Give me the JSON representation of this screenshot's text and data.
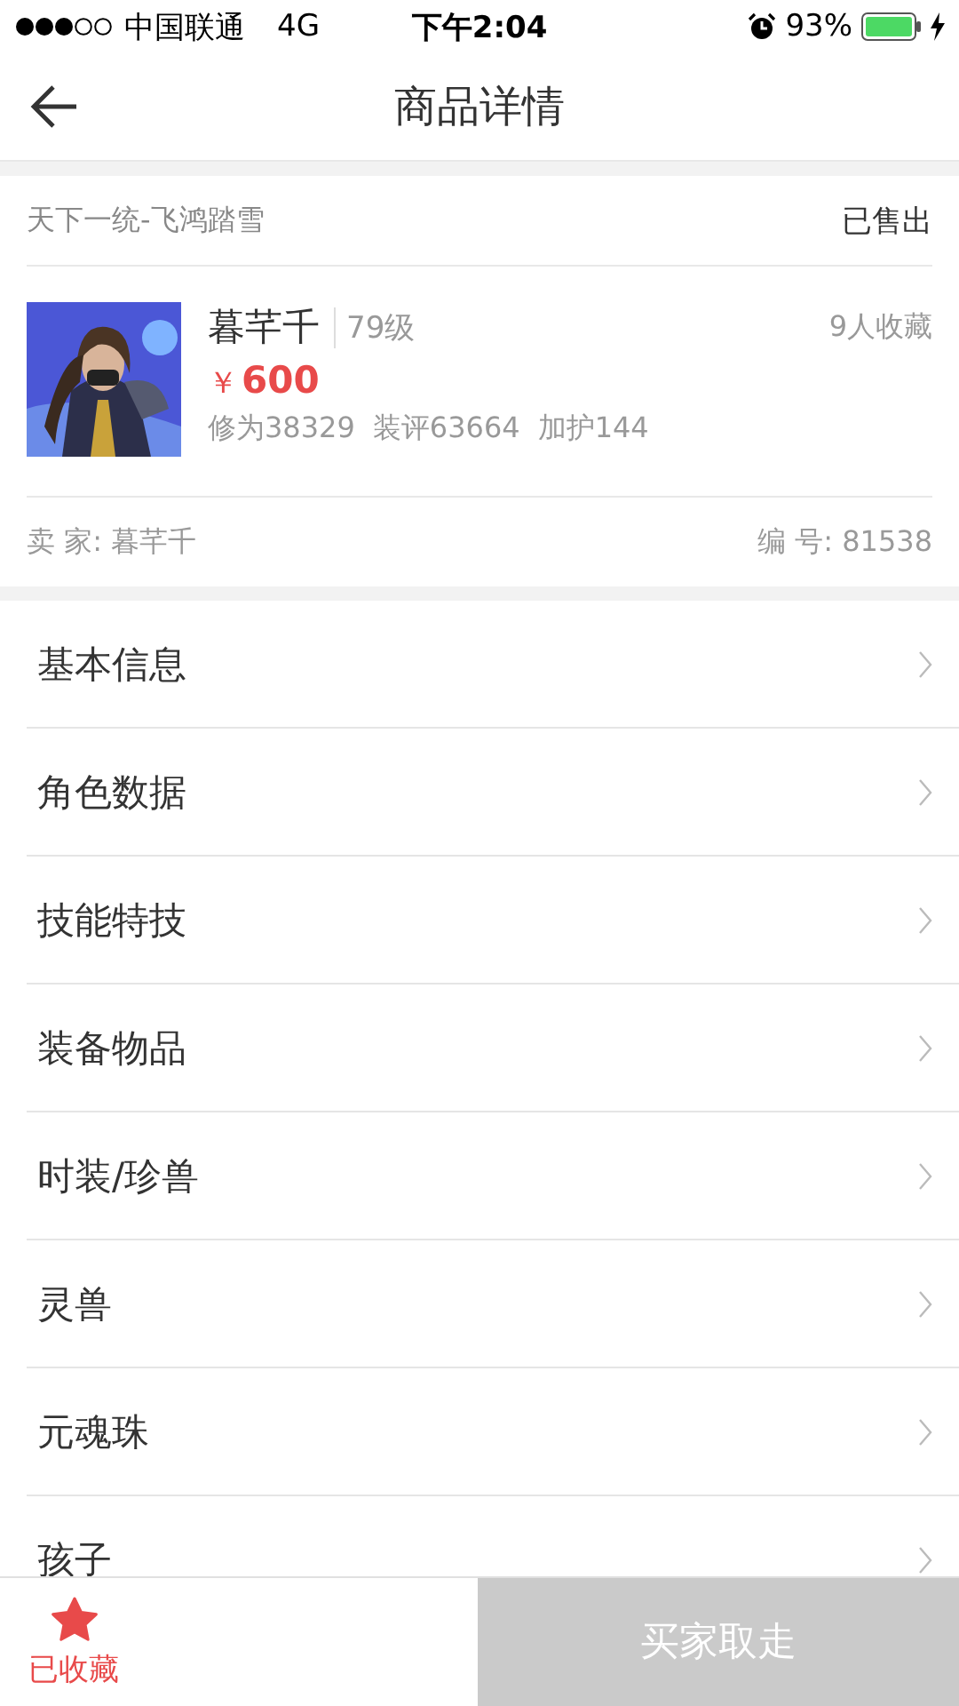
{
  "status_bar": {
    "carrier": "中国联通",
    "network": "4G",
    "time": "下午2:04",
    "battery_text": "93%"
  },
  "nav": {
    "title": "商品详情"
  },
  "product": {
    "server": "天下一统-飞鸿踏雪",
    "status": "已售出",
    "name": "暮芊千",
    "level": "79级",
    "favorites": "9人收藏",
    "price_symbol": "￥",
    "price": "600",
    "stats": [
      "修为38329",
      "装评63664",
      "加护144"
    ],
    "seller_label": "卖 家:",
    "seller": "暮芊千",
    "id_label": "编 号:",
    "id": "81538"
  },
  "menu": [
    {
      "label": "基本信息"
    },
    {
      "label": "角色数据"
    },
    {
      "label": "技能特技"
    },
    {
      "label": "装备物品"
    },
    {
      "label": "时装/珍兽"
    },
    {
      "label": "灵兽"
    },
    {
      "label": "元魂珠"
    },
    {
      "label": "孩子"
    }
  ],
  "footer": {
    "favorite": {
      "label": "已收藏",
      "favorited": true
    },
    "buy_button": {
      "label": "买家取走",
      "disabled": true
    }
  }
}
